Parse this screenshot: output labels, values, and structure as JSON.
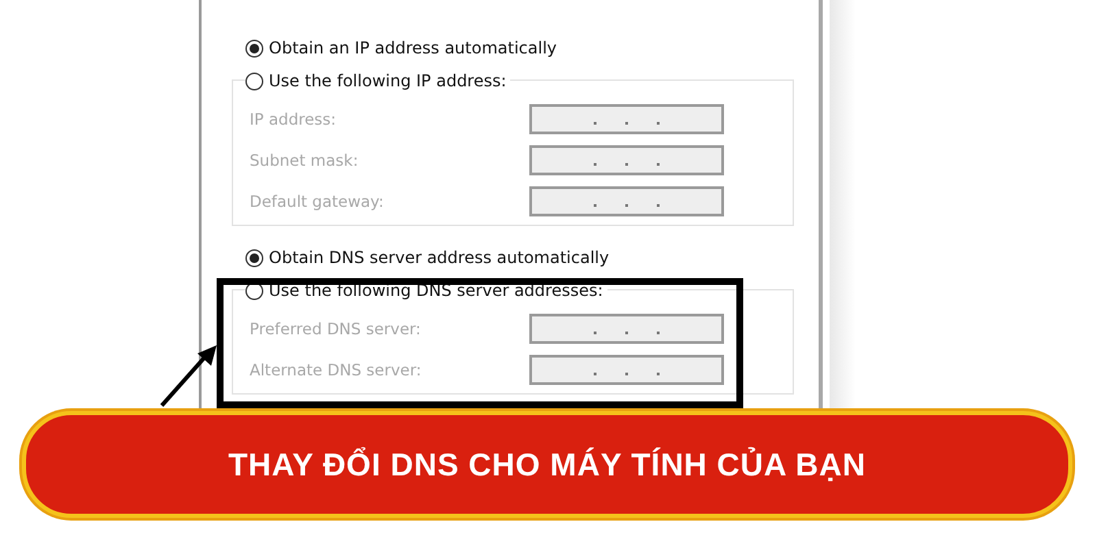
{
  "ip_section": {
    "options": [
      {
        "label": "Obtain an IP address automatically",
        "selected": true
      },
      {
        "label": "Use the following IP address:",
        "selected": false
      }
    ],
    "fields": [
      {
        "label": "IP address:",
        "disabled": true
      },
      {
        "label": "Subnet mask:",
        "disabled": true
      },
      {
        "label": "Default gateway:",
        "disabled": true
      }
    ]
  },
  "dns_section": {
    "options": [
      {
        "label": "Obtain DNS server address automatically",
        "selected": true
      },
      {
        "label": "Use the following DNS server addresses:",
        "selected": false
      }
    ],
    "fields": [
      {
        "label": "Preferred DNS server:",
        "disabled": true
      },
      {
        "label": "Alternate DNS server:",
        "disabled": true
      }
    ]
  },
  "banner": {
    "title": "THAY ĐỔI DNS CHO MÁY TÍNH CỦA BẠN"
  }
}
